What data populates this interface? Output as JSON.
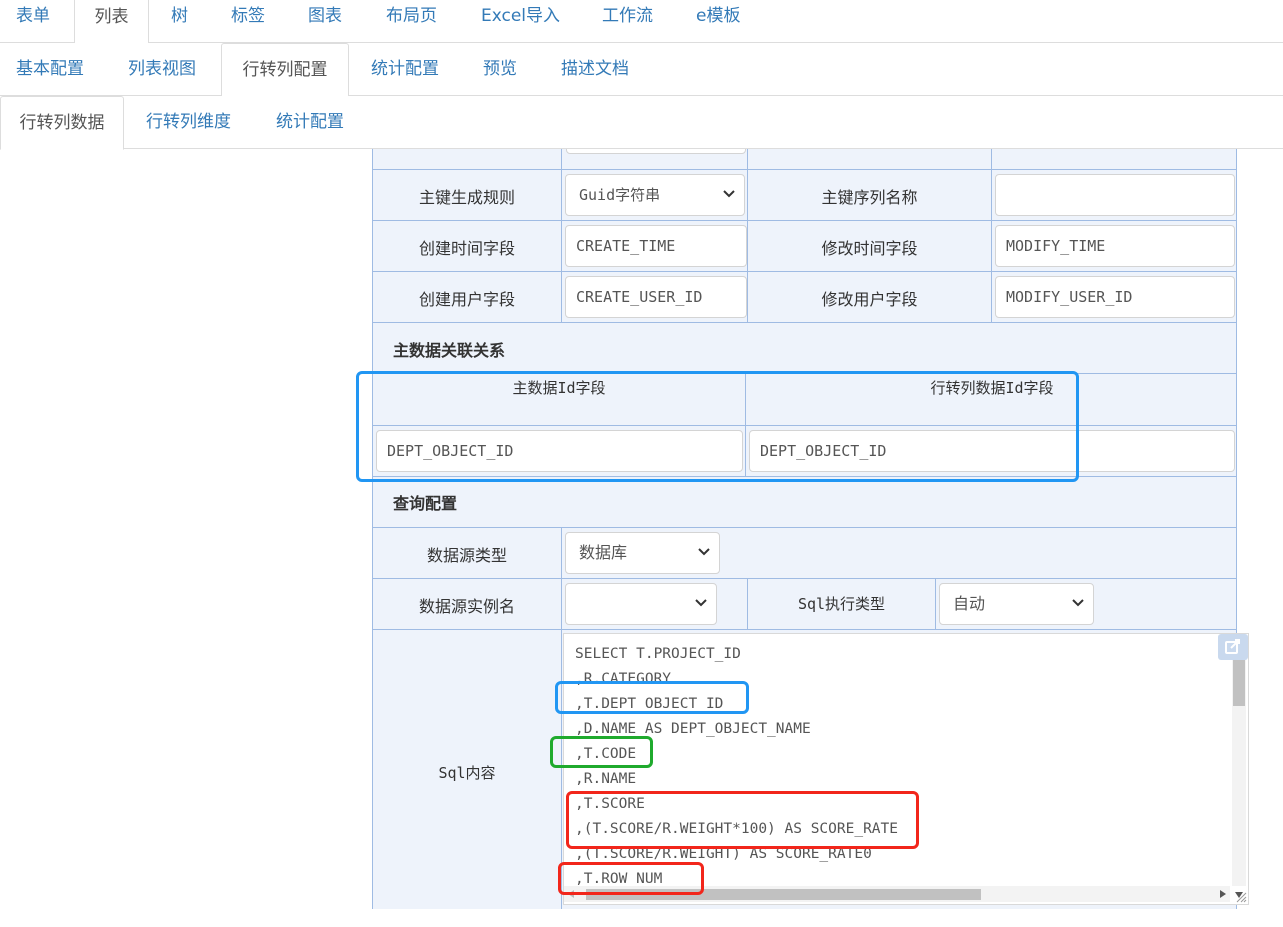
{
  "tabs_level1": [
    "表单",
    "列表",
    "树",
    "标签",
    "图表",
    "布局页",
    "Excel导入",
    "工作流",
    "e模板"
  ],
  "tabs_level2": [
    "基本配置",
    "列表视图",
    "行转列配置",
    "统计配置",
    "预览",
    "描述文档"
  ],
  "tabs_level3": [
    "行转列数据",
    "行转列维度",
    "统计配置"
  ],
  "form": {
    "pk_rule_label": "主键生成规则",
    "pk_rule_value": "Guid字符串",
    "pk_seq_label": "主键序列名称",
    "pk_seq_value": "",
    "create_time_label": "创建时间字段",
    "create_time_value": "CREATE_TIME",
    "modify_time_label": "修改时间字段",
    "modify_time_value": "MODIFY_TIME",
    "create_user_label": "创建用户字段",
    "create_user_value": "CREATE_USER_ID",
    "modify_user_label": "修改用户字段",
    "modify_user_value": "MODIFY_USER_ID"
  },
  "relation": {
    "section_title": "主数据关联关系",
    "master_id_label": "主数据Id字段",
    "pivot_id_label": "行转列数据Id字段",
    "master_id_value": "DEPT_OBJECT_ID",
    "pivot_id_value": "DEPT_OBJECT_ID"
  },
  "query": {
    "section_title": "查询配置",
    "ds_type_label": "数据源类型",
    "ds_type_value": "数据库",
    "ds_instance_label": "数据源实例名",
    "ds_instance_value": "",
    "sql_exec_label": "Sql执行类型",
    "sql_exec_value": "自动",
    "sql_content_label": "Sql内容",
    "sql_lines": [
      "SELECT T.PROJECT_ID",
      ",R.CATEGORY",
      ",T.DEPT_OBJECT_ID",
      ",D.NAME AS DEPT_OBJECT_NAME",
      ",T.CODE",
      ",R.NAME",
      ",T.SCORE",
      ",(T.SCORE/R.WEIGHT*100) AS SCORE_RATE",
      ",(T.SCORE/R.WEIGHT) AS SCORE_RATE0",
      ",T.ROW_NUM"
    ]
  },
  "colors": {
    "link": "#337ab7",
    "grid_border": "#9fbbe3",
    "grid_bg": "#eef3fb",
    "annotation_blue": "#2196f3",
    "annotation_green": "#1faa2d",
    "annotation_red": "#f2261b"
  }
}
